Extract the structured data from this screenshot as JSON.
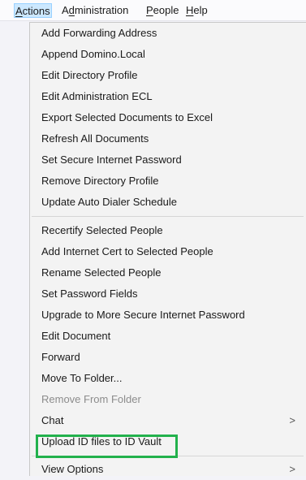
{
  "menubar": {
    "items": [
      {
        "pre": "",
        "ul": "A",
        "post": "ctions"
      },
      {
        "pre": "A",
        "ul": "d",
        "post": "ministration"
      },
      {
        "pre": "",
        "ul": "P",
        "post": "eople"
      },
      {
        "pre": "",
        "ul": "H",
        "post": "elp"
      }
    ]
  },
  "menu": {
    "group1": [
      "Add Forwarding Address",
      "Append Domino.Local",
      "Edit Directory Profile",
      "Edit Administration ECL",
      "Export Selected Documents to Excel",
      "Refresh All Documents",
      "Set Secure Internet Password",
      "Remove Directory Profile",
      "Update Auto Dialer Schedule"
    ],
    "group2": [
      "Recertify Selected People",
      "Add Internet Cert to Selected People",
      "Rename Selected People",
      "Set Password Fields",
      "Upgrade to More Secure Internet Password",
      "Edit Document",
      "Forward",
      "Move To Folder...",
      "Remove From Folder",
      "Chat",
      "Upload ID files to ID Vault"
    ],
    "group3": [
      "View Options"
    ],
    "submenu_arrow": ">"
  }
}
